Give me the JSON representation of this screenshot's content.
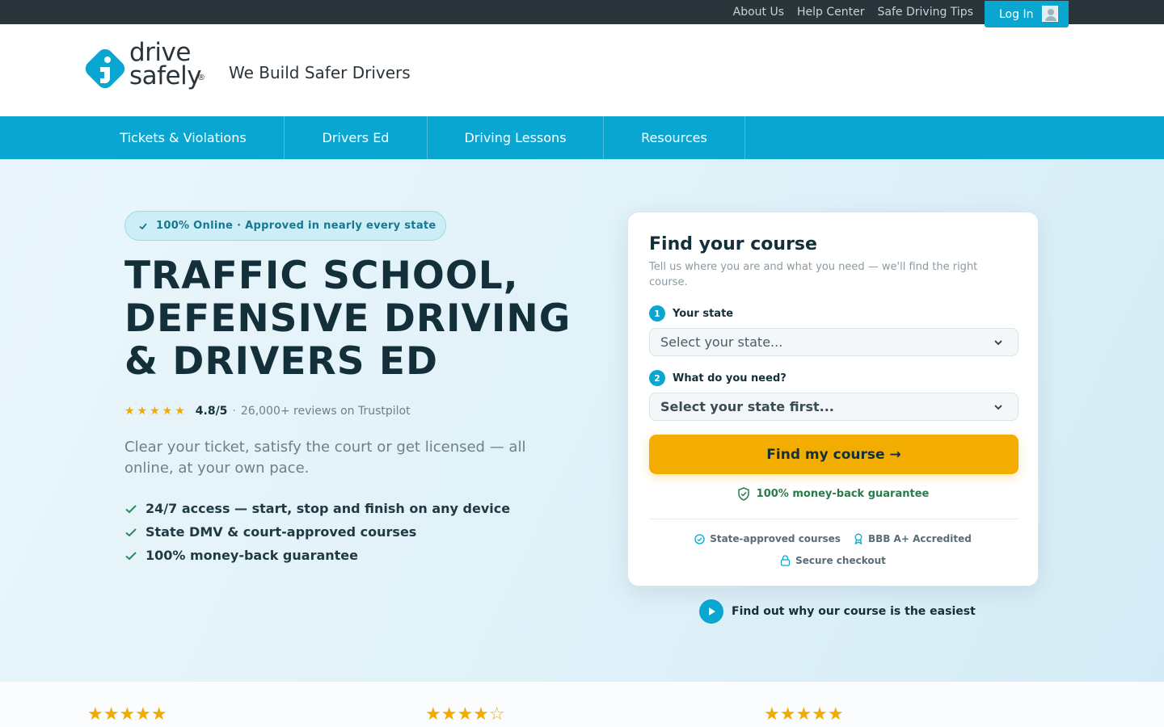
{
  "topbar": {
    "links": [
      "About Us",
      "Help Center",
      "Safe Driving Tips"
    ],
    "login_label": "Log In"
  },
  "header": {
    "logo_line1": "drive",
    "logo_line2": "safely",
    "logo_reg": "®",
    "tagline": "We Build Safer Drivers"
  },
  "nav": {
    "items": [
      "Tickets & Violations",
      "Drivers Ed",
      "Driving Lessons",
      "Resources"
    ]
  },
  "hero": {
    "pill": "100% Online · Approved in nearly every state",
    "headline": [
      "TRAFFIC SCHOOL,",
      "DEFENSIVE DRIVING",
      "& DRIVERS ED"
    ],
    "rating_stars": "★★★★★",
    "rating_score": "4.8/5",
    "rating_sep": "·",
    "rating_reviews": "26,000+ reviews on Trustpilot",
    "lead": "Clear your ticket, satisfy the court or get licensed — all online, at your own pace.",
    "bullets": [
      "24/7 access — start, stop and finish on any device",
      "State DMV & court-approved courses",
      "100% money-back guarantee"
    ]
  },
  "card": {
    "title": "Find your course",
    "subtitle": "Tell us where you are and what you need — we'll find the right course.",
    "step1_num": "1",
    "step1_label": "Your state",
    "step1_value": "Select your state...",
    "step2_num": "2",
    "step2_label": "What do you need?",
    "step2_value": "Select your state first...",
    "cta": "Find my course →",
    "guarantee": "100% money-back guarantee",
    "trust": [
      "State-approved courses",
      "BBB A+ Accredited",
      "Secure checkout"
    ]
  },
  "video": {
    "label": "Find out why our course is the easiest"
  },
  "review_strip": {
    "ratings": [
      "★★★★★",
      "★★★★☆",
      "★★★★★"
    ]
  },
  "colors": {
    "brand": "#0aa6d2",
    "cta": "#f2ad00",
    "dark": "#2a343b",
    "heading": "#13303a"
  }
}
